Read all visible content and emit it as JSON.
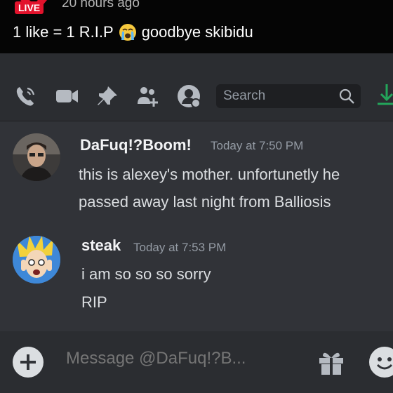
{
  "video": {
    "live_badge": "LIVE",
    "time_ago": "20 hours ago",
    "caption_before": "1 like = 1 R.I.P",
    "caption_after": "goodbye skibidu"
  },
  "toolbar": {
    "icons": [
      "phone-call-icon",
      "video-camera-icon",
      "pin-icon",
      "add-friend-icon",
      "user-profile-icon"
    ],
    "search_placeholder": "Search"
  },
  "messages": [
    {
      "author": "DaFuq!?Boom!",
      "timestamp": "Today at 7:50 PM",
      "lines": [
        "this is alexey's mother. unfortunetly he",
        "passed away last night from Balliosis"
      ]
    },
    {
      "author": "steak",
      "timestamp": "Today at 7:53 PM",
      "lines": [
        "i am so so so sorry",
        "RIP"
      ]
    }
  ],
  "composer": {
    "placeholder": "Message @DaFuq!?B..."
  },
  "colors": {
    "background": "#313338",
    "toolbar": "#2b2d31",
    "live_red": "#e2132c",
    "download_green": "#23a55a"
  }
}
